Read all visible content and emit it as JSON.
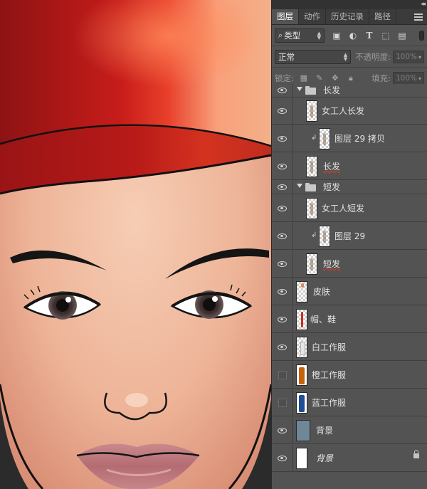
{
  "panel": {
    "tabs": [
      {
        "label": "图层",
        "active": true
      },
      {
        "label": "动作",
        "active": false
      },
      {
        "label": "历史记录",
        "active": false
      },
      {
        "label": "路径",
        "active": false
      }
    ],
    "filter": {
      "type_label": "类型"
    },
    "blend": {
      "mode": "正常",
      "opacity_label": "不透明度:",
      "opacity_value": "100%"
    },
    "lock": {
      "label": "锁定:",
      "fill_label": "填充:",
      "fill_value": "100%"
    }
  },
  "layers": [
    {
      "name": "长发",
      "kind": "group",
      "visible": true
    },
    {
      "name": "女工人长发",
      "kind": "layer",
      "visible": true,
      "thumb": "hair"
    },
    {
      "name": "图层 29 拷贝",
      "kind": "layer",
      "visible": true,
      "thumb": "hair",
      "clipped": true
    },
    {
      "name": "长发",
      "kind": "layer",
      "visible": true,
      "thumb": "hair",
      "style": "underline"
    },
    {
      "name": "短发",
      "kind": "group",
      "visible": true
    },
    {
      "name": "女工人短发",
      "kind": "layer",
      "visible": true,
      "thumb": "hair"
    },
    {
      "name": "图层 29",
      "kind": "layer",
      "visible": true,
      "thumb": "hair",
      "clipped": true
    },
    {
      "name": "短发",
      "kind": "layer",
      "visible": true,
      "thumb": "hair",
      "style": "underline"
    },
    {
      "name": "皮肤",
      "kind": "layer",
      "visible": true,
      "thumb": "skin"
    },
    {
      "name": "帽、鞋",
      "kind": "layer",
      "visible": true,
      "thumb": "hat"
    },
    {
      "name": "白工作服",
      "kind": "layer",
      "visible": true,
      "thumb": "white"
    },
    {
      "name": "橙工作服",
      "kind": "layer",
      "visible": false,
      "thumb": "orange"
    },
    {
      "name": "蓝工作服",
      "kind": "layer",
      "visible": false,
      "thumb": "blue"
    },
    {
      "name": "背景",
      "kind": "layer",
      "visible": true,
      "thumb": "gray"
    },
    {
      "name": "背景",
      "kind": "layer",
      "visible": true,
      "thumb": "solid",
      "style": "italic",
      "locked": true
    }
  ],
  "colors": {
    "hat_red": "#c8201a",
    "skin": "#f1bba2",
    "panel_bg": "#535353"
  }
}
